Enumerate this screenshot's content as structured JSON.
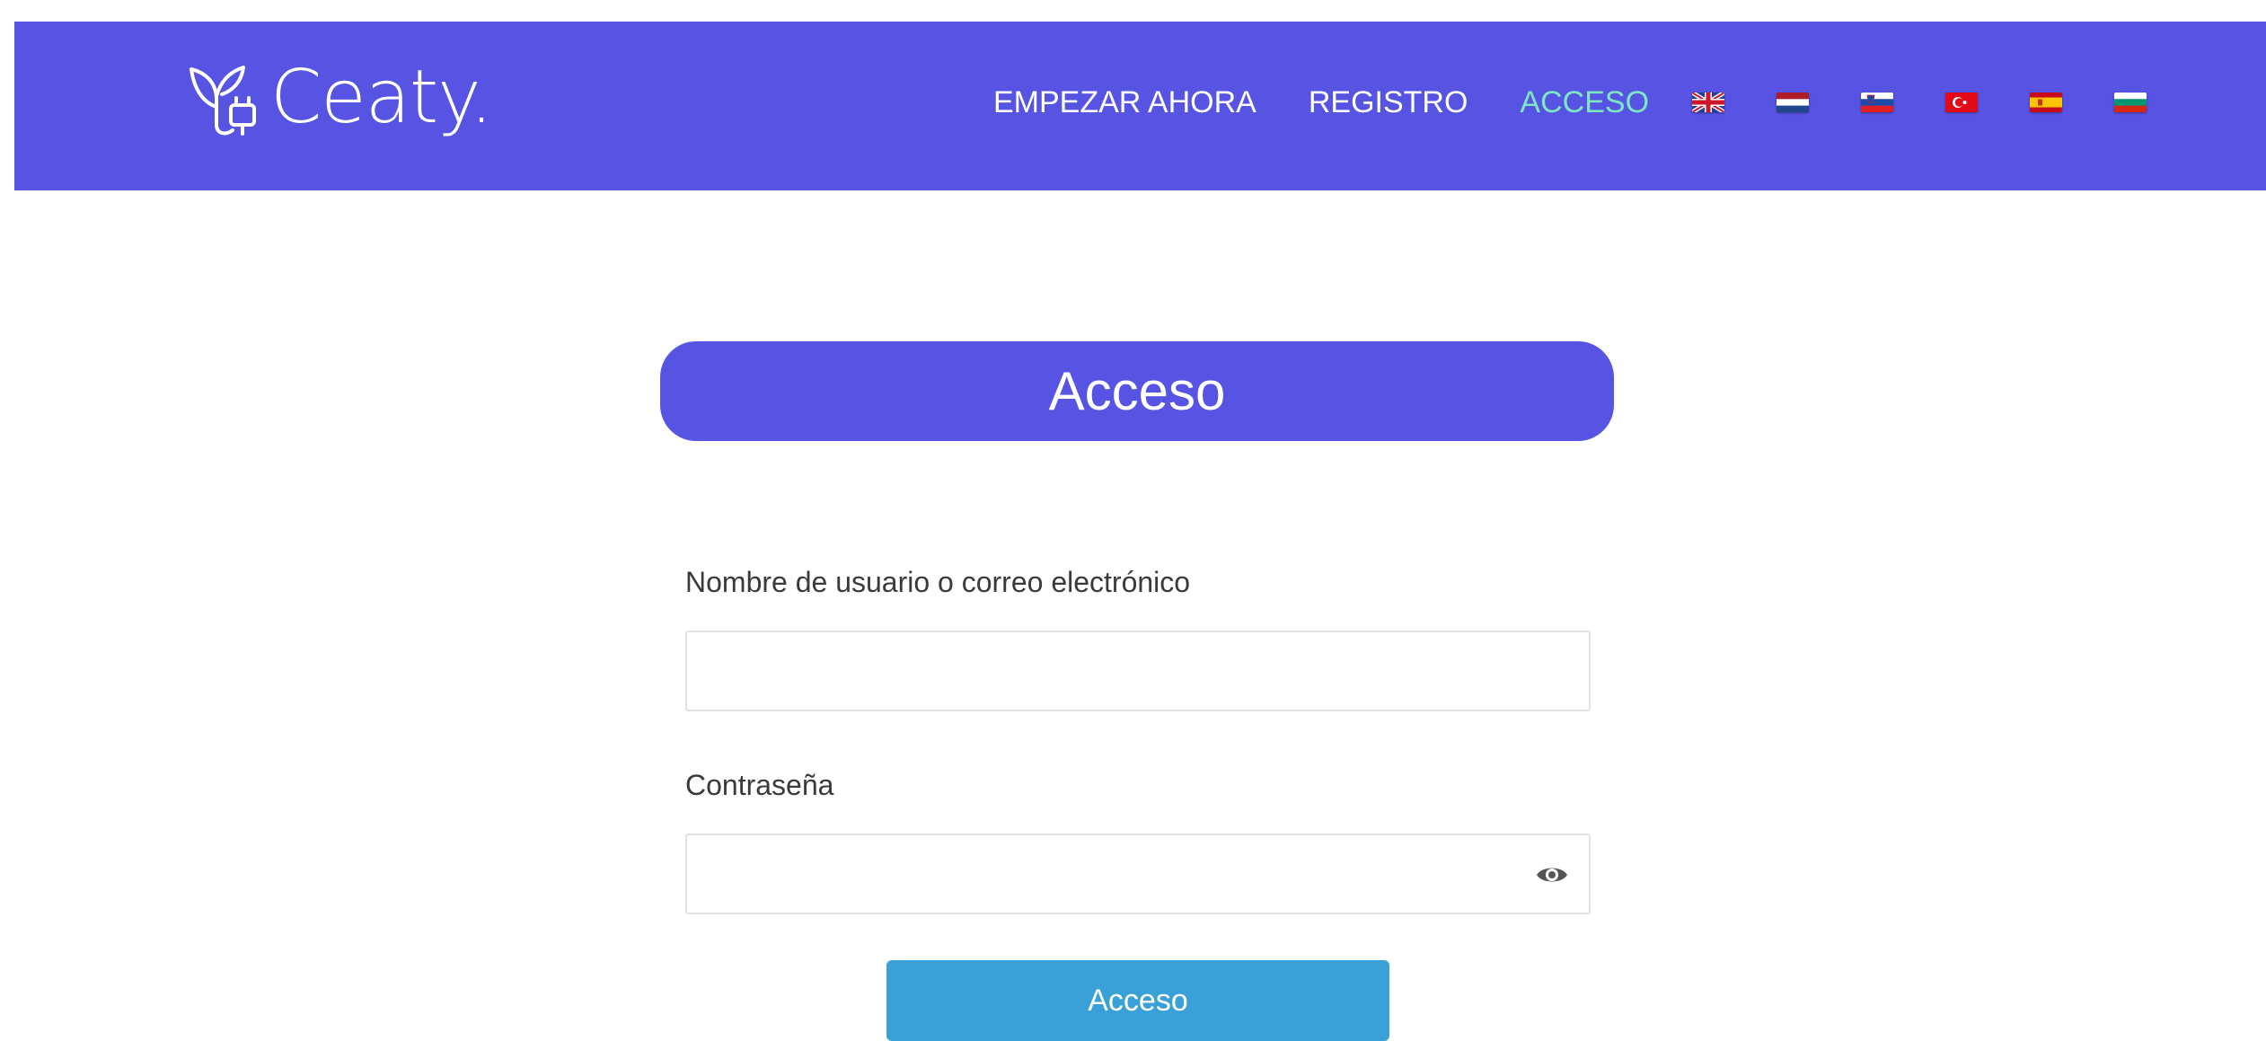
{
  "brand": {
    "name": "Ceaty.",
    "accent_color": "#5753e3"
  },
  "nav": {
    "items": [
      {
        "label": "EMPEZAR AHORA",
        "active": false
      },
      {
        "label": "REGISTRO",
        "active": false
      },
      {
        "label": "ACCESO",
        "active": true
      }
    ],
    "active_color": "#7ee6c0",
    "languages": [
      {
        "icon": "uk-flag-icon"
      },
      {
        "icon": "netherlands-flag-icon"
      },
      {
        "icon": "slovenia-flag-icon"
      },
      {
        "icon": "turkey-flag-icon"
      },
      {
        "icon": "spain-flag-icon"
      },
      {
        "icon": "bulgaria-flag-icon"
      }
    ]
  },
  "page": {
    "title": "Acceso"
  },
  "form": {
    "username_label": "Nombre de usuario o correo electrónico",
    "username_value": "",
    "password_label": "Contraseña",
    "password_value": "",
    "password_toggle_icon": "eye-icon",
    "submit_label": "Acceso",
    "submit_color": "#3aa0d8"
  }
}
